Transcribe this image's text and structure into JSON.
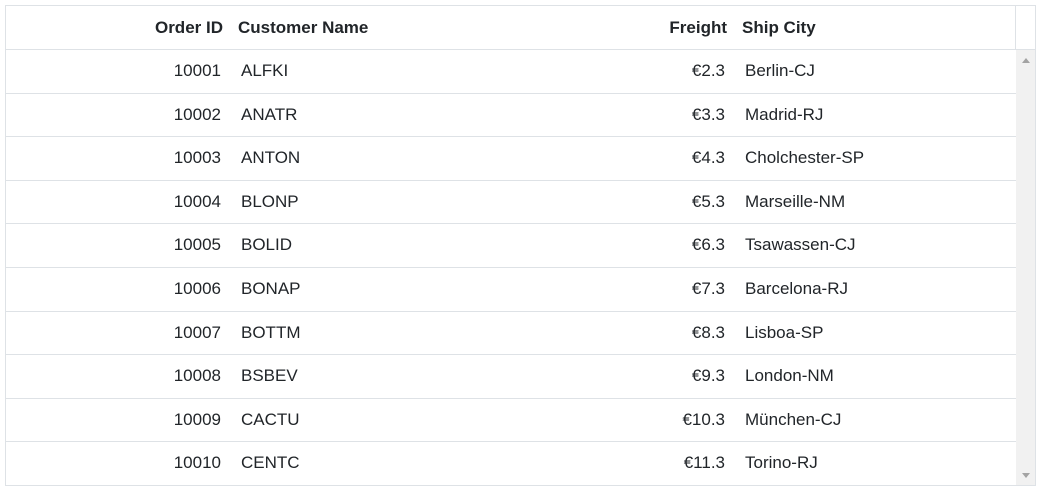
{
  "grid": {
    "columns": [
      {
        "key": "order_id",
        "label": "Order ID"
      },
      {
        "key": "customer_name",
        "label": "Customer Name"
      },
      {
        "key": "freight",
        "label": "Freight"
      },
      {
        "key": "ship_city",
        "label": "Ship City"
      }
    ],
    "rows": [
      {
        "order_id": "10001",
        "customer_name": "ALFKI",
        "freight": "€2.3",
        "ship_city": "Berlin-CJ"
      },
      {
        "order_id": "10002",
        "customer_name": "ANATR",
        "freight": "€3.3",
        "ship_city": "Madrid-RJ"
      },
      {
        "order_id": "10003",
        "customer_name": "ANTON",
        "freight": "€4.3",
        "ship_city": "Cholchester-SP"
      },
      {
        "order_id": "10004",
        "customer_name": "BLONP",
        "freight": "€5.3",
        "ship_city": "Marseille-NM"
      },
      {
        "order_id": "10005",
        "customer_name": "BOLID",
        "freight": "€6.3",
        "ship_city": "Tsawassen-CJ"
      },
      {
        "order_id": "10006",
        "customer_name": "BONAP",
        "freight": "€7.3",
        "ship_city": "Barcelona-RJ"
      },
      {
        "order_id": "10007",
        "customer_name": "BOTTM",
        "freight": "€8.3",
        "ship_city": "Lisboa-SP"
      },
      {
        "order_id": "10008",
        "customer_name": "BSBEV",
        "freight": "€9.3",
        "ship_city": "London-NM"
      },
      {
        "order_id": "10009",
        "customer_name": "CACTU",
        "freight": "€10.3",
        "ship_city": "München-CJ"
      },
      {
        "order_id": "10010",
        "customer_name": "CENTC",
        "freight": "€11.3",
        "ship_city": "Torino-RJ"
      }
    ]
  },
  "icons": {
    "scroll_up": "scroll-up-arrow-icon",
    "scroll_down": "scroll-down-arrow-icon"
  },
  "colors": {
    "border": "#dee2e6",
    "text": "#212529",
    "scrollbar_track": "#f1f1f1"
  }
}
